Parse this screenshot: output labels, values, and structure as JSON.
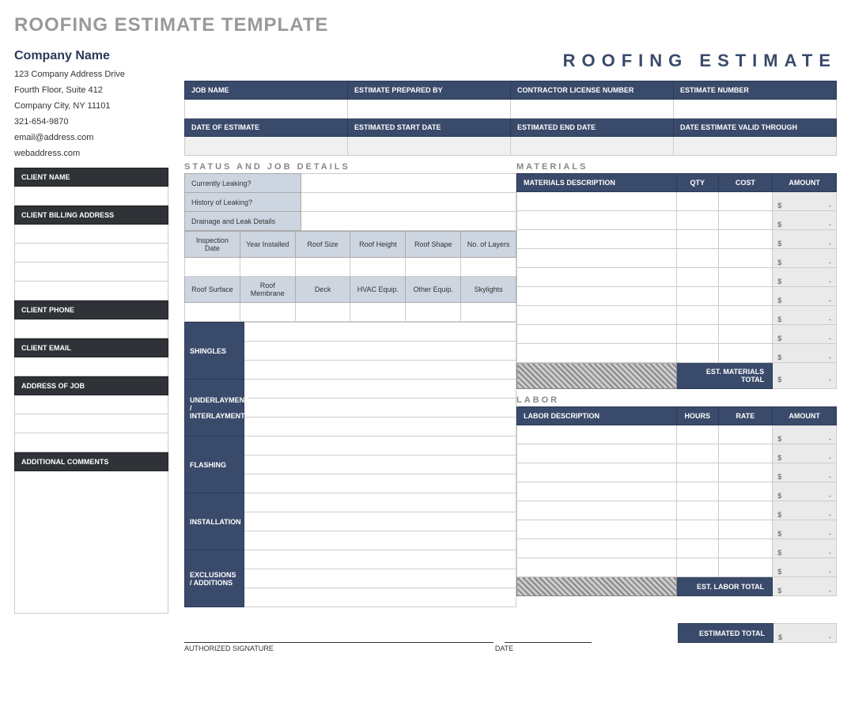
{
  "page_title": "ROOFING ESTIMATE TEMPLATE",
  "right_title": "ROOFING ESTIMATE",
  "company": {
    "name": "Company Name",
    "addr1": "123 Company Address Drive",
    "addr2": "Fourth Floor, Suite 412",
    "addr3": "Company City, NY  11101",
    "phone": "321-654-9870",
    "email": "email@address.com",
    "web": "webaddress.com"
  },
  "info_headers": {
    "job_name": "JOB NAME",
    "prepared_by": "ESTIMATE PREPARED BY",
    "license": "CONTRACTOR LICENSE NUMBER",
    "est_no": "ESTIMATE NUMBER",
    "date_est": "DATE OF ESTIMATE",
    "start": "ESTIMATED START DATE",
    "end": "ESTIMATED END DATE",
    "valid": "DATE ESTIMATE VALID THROUGH"
  },
  "left": {
    "client_name": "CLIENT NAME",
    "billing": "CLIENT BILLING ADDRESS",
    "phone": "CLIENT PHONE",
    "email": "CLIENT EMAIL",
    "job_addr": "ADDRESS OF JOB",
    "comments": "ADDITIONAL COMMENTS"
  },
  "status": {
    "title": "STATUS AND JOB DETAILS",
    "leaking": "Currently Leaking?",
    "history": "History of Leaking?",
    "drainage": "Drainage and Leak Details",
    "grid1": [
      "Inspection Date",
      "Year Installed",
      "Roof Size",
      "Roof Height",
      "Roof Shape",
      "No. of Layers"
    ],
    "grid2": [
      "Roof Surface",
      "Roof Membrane",
      "Deck",
      "HVAC Equip.",
      "Other Equip.",
      "Skylights"
    ],
    "sections": [
      "SHINGLES",
      "UNDERLAYMENT / INTERLAYMENT",
      "FLASHING",
      "INSTALLATION",
      "EXCLUSIONS / ADDITIONS"
    ]
  },
  "materials": {
    "title": "MATERIALS",
    "h": [
      "MATERIALS DESCRIPTION",
      "QTY",
      "COST",
      "AMOUNT"
    ],
    "total": "EST. MATERIALS  TOTAL"
  },
  "labor": {
    "title": "LABOR",
    "h": [
      "LABOR DESCRIPTION",
      "HOURS",
      "RATE",
      "AMOUNT"
    ],
    "total": "EST. LABOR TOTAL"
  },
  "footer": {
    "sig": "AUTHORIZED SIGNATURE",
    "date": "DATE",
    "est_total": "ESTIMATED TOTAL"
  }
}
